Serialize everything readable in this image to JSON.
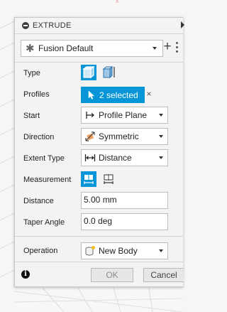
{
  "dialog": {
    "title": "EXTRUDE",
    "preset": "Fusion Default",
    "plus_label": "+",
    "rows": {
      "type_label": "Type",
      "profiles_label": "Profiles",
      "profiles_value": "2 selected",
      "clear_glyph": "×",
      "start_label": "Start",
      "start_value": "Profile Plane",
      "direction_label": "Direction",
      "direction_value": "Symmetric",
      "extent_label": "Extent Type",
      "extent_value": "Distance",
      "measurement_label": "Measurement",
      "distance_label": "Distance",
      "distance_value": "5.00 mm",
      "taper_label": "Taper Angle",
      "taper_value": "0.0 deg",
      "operation_label": "Operation",
      "operation_value": "New Body"
    },
    "footer": {
      "info_glyph": "i",
      "ok_label": "OK",
      "cancel_label": "Cancel"
    }
  },
  "colors": {
    "accent": "#0696d7",
    "panel": "#f3f3f3"
  },
  "icons": {
    "title": "collapse-icon",
    "type_solid": "extrude-solid-icon",
    "type_thin": "extrude-thin-icon",
    "start": "profile-plane-icon",
    "direction": "symmetric-direction-icon",
    "extent": "distance-extent-icon",
    "measurement_half": "half-length-icon",
    "measurement_whole": "whole-length-icon",
    "operation": "new-body-icon"
  }
}
